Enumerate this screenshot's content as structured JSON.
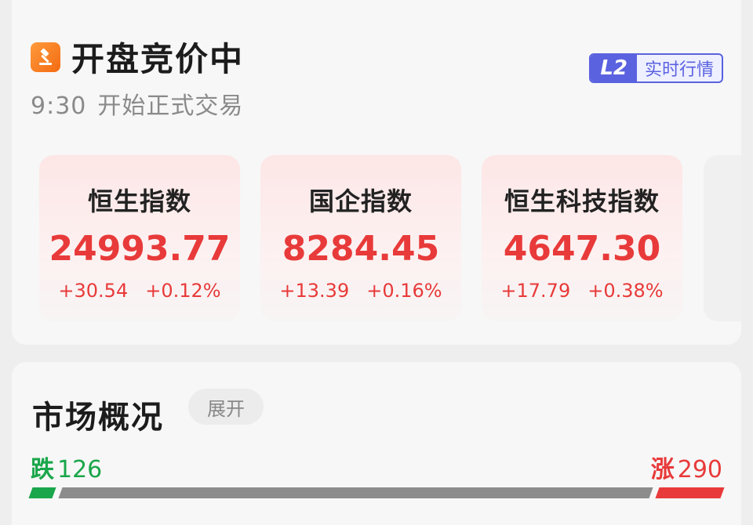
{
  "header": {
    "icon": "auction-hammer-icon",
    "title": "开盘竞价中",
    "time": "9:30",
    "subtitle": "开始正式交易",
    "badge_l2": "L2",
    "badge_text": "实时行情"
  },
  "indices": [
    {
      "name": "恒生指数",
      "value": "24993.77",
      "change": "+30.54",
      "pct": "+0.12%"
    },
    {
      "name": "国企指数",
      "value": "8284.45",
      "change": "+13.39",
      "pct": "+0.16%"
    },
    {
      "name": "恒生科技指数",
      "value": "4647.30",
      "change": "+17.79",
      "pct": "+0.38%"
    }
  ],
  "next_card_peek": "A",
  "market": {
    "title": "市场概况",
    "expand_label": "展开",
    "fall_label": "跌",
    "fall_count": "126",
    "rise_label": "涨",
    "rise_count": "290",
    "fall_fraction": 0.034,
    "rise_fraction": 0.094
  },
  "colors": {
    "rise": "#e83a3a",
    "fall": "#1aa64a",
    "flat": "#8c8c8c",
    "accent": "#5b62e0"
  }
}
